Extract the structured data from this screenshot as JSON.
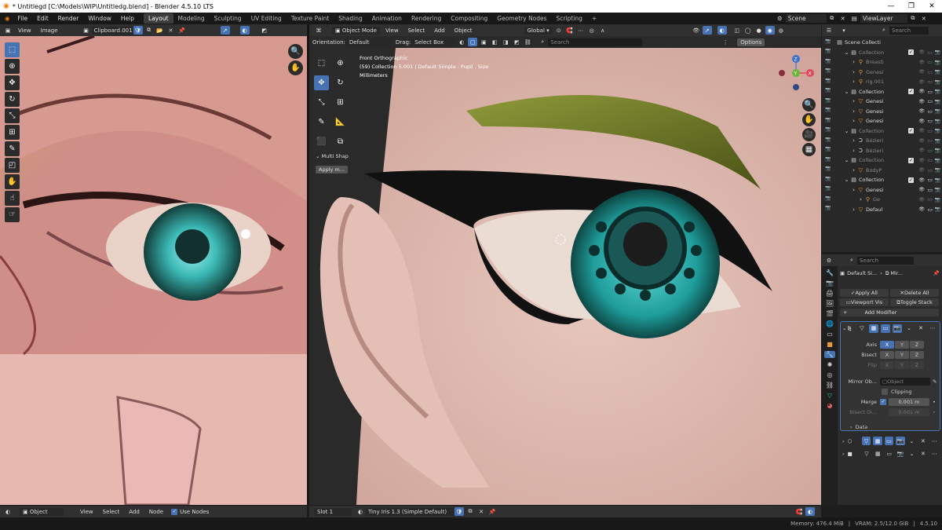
{
  "window": {
    "title": "* Untitlegd [C:\\Models\\WIP\\Untitledg.blend] - Blender 4.5.10 LTS",
    "minimize": "—",
    "maximize": "❐",
    "close": "✕"
  },
  "menu": [
    "File",
    "Edit",
    "Render",
    "Window",
    "Help"
  ],
  "workspaces": [
    "Layout",
    "Modeling",
    "Sculpting",
    "UV Editing",
    "Texture Paint",
    "Shading",
    "Animation",
    "Rendering",
    "Compositing",
    "Geometry Nodes",
    "Scripting",
    "+"
  ],
  "scene": {
    "label": "Scene",
    "view_layer": "ViewLayer"
  },
  "image_editor": {
    "view": "View",
    "image": "Image",
    "image_name": "Clipboard.001"
  },
  "viewport": {
    "mode": "Object Mode",
    "view": "View",
    "select": "Select",
    "add": "Add",
    "object": "Object",
    "transform": "Global",
    "orientation_label": "Orientation:",
    "orientation": "Default",
    "drag_label": "Drag:",
    "drag": "Select Box",
    "options": "Options",
    "search_placeholder": "Search",
    "overlay_line1": "Front Orthographic",
    "overlay_line2": "(59) Collection 5.001 | Default Simple : Pupil . Size",
    "overlay_line3": "Millimeters",
    "panel_title": "Multi Shap",
    "panel_button": "Apply m..."
  },
  "gizmo": {
    "x": "X",
    "y": "Y",
    "z": "Z"
  },
  "outliner": {
    "search_placeholder": "Search",
    "items": [
      {
        "label": "Scene Collecti",
        "indent": 0,
        "icon": "▤",
        "dim": false
      },
      {
        "label": "Collection",
        "indent": 1,
        "icon": "▤",
        "dim": true
      },
      {
        "label": "Breasti",
        "indent": 2,
        "icon": "⚲",
        "dim": true
      },
      {
        "label": "Genesi",
        "indent": 2,
        "icon": "⚲",
        "dim": true
      },
      {
        "label": "rig.001",
        "indent": 2,
        "icon": "⚲",
        "dim": true
      },
      {
        "label": "Collection",
        "indent": 1,
        "icon": "▤",
        "dim": false
      },
      {
        "label": "Genesi",
        "indent": 2,
        "icon": "▽",
        "dim": false
      },
      {
        "label": "Genesi",
        "indent": 2,
        "icon": "▽",
        "dim": false
      },
      {
        "label": "Genesi",
        "indent": 2,
        "icon": "▽",
        "dim": false
      },
      {
        "label": "Collection",
        "indent": 1,
        "icon": "▤",
        "dim": true
      },
      {
        "label": "Bézieri",
        "indent": 2,
        "icon": "Ↄ",
        "dim": true
      },
      {
        "label": "Bézieri",
        "indent": 2,
        "icon": "Ↄ",
        "dim": true
      },
      {
        "label": "Collection",
        "indent": 1,
        "icon": "▤",
        "dim": true
      },
      {
        "label": "BodyP",
        "indent": 2,
        "icon": "▽",
        "dim": true
      },
      {
        "label": "Collection",
        "indent": 1,
        "icon": "▤",
        "dim": false
      },
      {
        "label": "Genesi",
        "indent": 2,
        "icon": "▽",
        "dim": false
      },
      {
        "label": "Ge",
        "indent": 3,
        "icon": "⚲",
        "dim": true
      },
      {
        "label": "Defaul",
        "indent": 2,
        "icon": "▽",
        "dim": false
      }
    ]
  },
  "properties": {
    "search_placeholder": "Search",
    "breadcrumb_object": "Default Si...",
    "breadcrumb_modifier": "Mir...",
    "apply_all": "Apply All",
    "delete_all": "Delete All",
    "viewport_vis": "Viewport Vis",
    "toggle_stack": "Toggle Stack",
    "add_modifier": "Add Modifier",
    "axis_label": "Axis",
    "bisect_label": "Bisect",
    "flip_label": "Flip",
    "x": "X",
    "y": "Y",
    "z": "Z",
    "mirror_object_label": "Mirror Ob...",
    "object_placeholder": "Object",
    "clipping": "Clipping",
    "merge_label": "Merge",
    "merge_value": "0.001 m",
    "bisect_dist_label": "Bisect Di...",
    "bisect_dist_value": "0.001 m",
    "data_label": "Data"
  },
  "bottom": {
    "object_mode": "Object",
    "view": "View",
    "select": "Select",
    "add": "Add",
    "node": "Node",
    "use_nodes": "Use Nodes",
    "slot": "Slot 1",
    "material": "Tiny Iris 1.3 (Simple Default)"
  },
  "status": {
    "memory": "Memory: 476.4 MiB",
    "vram": "VRAM: 2.5/12.0 GiB",
    "version": "4.5.10"
  }
}
